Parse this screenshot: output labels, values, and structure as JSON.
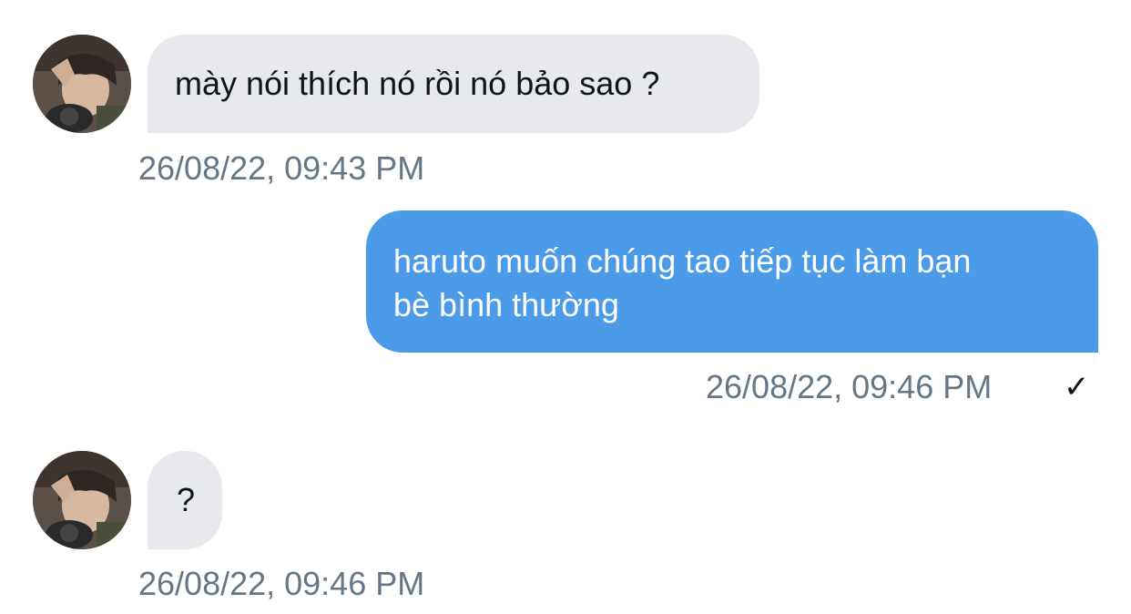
{
  "messages": [
    {
      "direction": "incoming",
      "text": "mày nói thích nó rồi nó bảo sao ?",
      "timestamp": "26/08/22, 09:43 PM"
    },
    {
      "direction": "outgoing",
      "text_line1": "haruto muốn chúng tao tiếp tục làm bạn",
      "text_line2": "bè bình thường",
      "timestamp": "26/08/22, 09:46 PM",
      "status_icon": "checkmark-icon"
    },
    {
      "direction": "incoming",
      "text": "?",
      "timestamp": "26/08/22, 09:46 PM"
    }
  ],
  "colors": {
    "incoming_bubble": "#e7e9ed",
    "outgoing_bubble": "#4c9be8",
    "timestamp": "#657786"
  },
  "status": {
    "check_glyph": "✓"
  }
}
